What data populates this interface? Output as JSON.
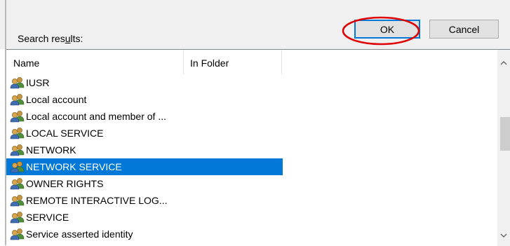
{
  "search_label_pre": "Search res",
  "search_label_mnemonic": "u",
  "search_label_post": "lts:",
  "buttons": {
    "ok": "OK",
    "cancel": "Cancel"
  },
  "columns": {
    "name": "Name",
    "in_folder": "In Folder"
  },
  "rows": [
    {
      "label": "IUSR",
      "selected": false
    },
    {
      "label": "Local account",
      "selected": false
    },
    {
      "label": "Local account and member of ...",
      "selected": false
    },
    {
      "label": "LOCAL SERVICE",
      "selected": false
    },
    {
      "label": "NETWORK",
      "selected": false
    },
    {
      "label": "NETWORK SERVICE",
      "selected": true
    },
    {
      "label": "OWNER RIGHTS",
      "selected": false
    },
    {
      "label": "REMOTE INTERACTIVE LOG...",
      "selected": false
    },
    {
      "label": "SERVICE",
      "selected": false
    },
    {
      "label": "Service asserted identity",
      "selected": false
    }
  ],
  "icons": {
    "row": "users-group-icon",
    "scroll_up": "chevron-up-icon",
    "scroll_down": "chevron-down-icon"
  },
  "colors": {
    "selection": "#0078d7",
    "highlight_oval": "#e00000",
    "focus_border": "#0078d7"
  }
}
